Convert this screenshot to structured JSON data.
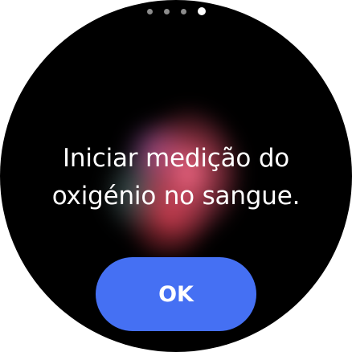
{
  "pager": {
    "total_pages": 4,
    "active_page": 4
  },
  "prompt": {
    "line1": "Iniciar medição do",
    "line2": "oxigénio no sangue."
  },
  "actions": {
    "ok_label": "OK"
  },
  "colors": {
    "background": "#000000",
    "button": "#4570f3",
    "text": "#ffffff"
  }
}
